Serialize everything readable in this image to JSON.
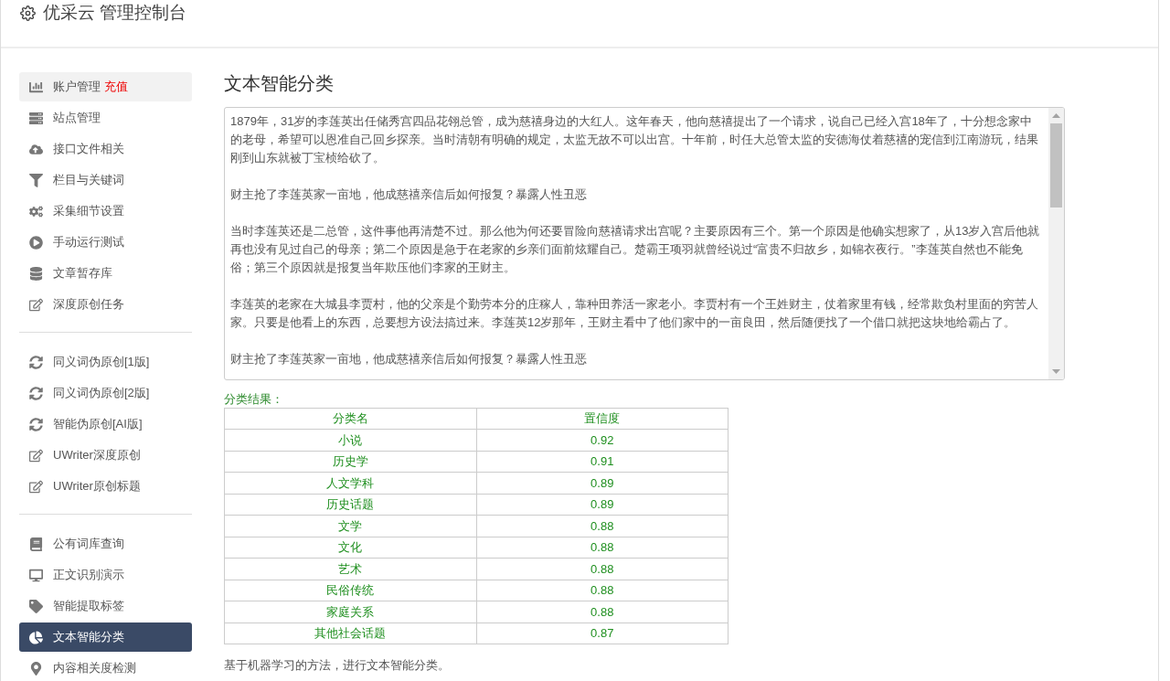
{
  "header": {
    "title": "优采云 管理控制台"
  },
  "sidebar": {
    "groups": [
      {
        "items": [
          {
            "label": "账户管理",
            "badge": "充值",
            "selected": false,
            "highlighted": true
          },
          {
            "label": "站点管理",
            "selected": false,
            "highlighted": false
          },
          {
            "label": "接口文件相关",
            "selected": false,
            "highlighted": false
          },
          {
            "label": "栏目与关键词",
            "selected": false,
            "highlighted": false
          },
          {
            "label": "采集细节设置",
            "selected": false,
            "highlighted": false
          },
          {
            "label": "手动运行测试",
            "selected": false,
            "highlighted": false
          },
          {
            "label": "文章暂存库",
            "selected": false,
            "highlighted": false
          },
          {
            "label": "深度原创任务",
            "selected": false,
            "highlighted": false
          }
        ]
      },
      {
        "items": [
          {
            "label": "同义词伪原创[1版]",
            "selected": false,
            "highlighted": false
          },
          {
            "label": "同义词伪原创[2版]",
            "selected": false,
            "highlighted": false
          },
          {
            "label": "智能伪原创[AI版]",
            "selected": false,
            "highlighted": false
          },
          {
            "label": "UWriter深度原创",
            "selected": false,
            "highlighted": false
          },
          {
            "label": "UWriter原创标题",
            "selected": false,
            "highlighted": false
          }
        ]
      },
      {
        "items": [
          {
            "label": "公有词库查询",
            "selected": false,
            "highlighted": false
          },
          {
            "label": "正文识别演示",
            "selected": false,
            "highlighted": false
          },
          {
            "label": "智能提取标签",
            "selected": false,
            "highlighted": false
          },
          {
            "label": "文本智能分类",
            "selected": true
          },
          {
            "label": "内容相关度检测",
            "selected": false,
            "highlighted": false
          }
        ]
      }
    ]
  },
  "main": {
    "title": "文本智能分类",
    "text_area": {
      "paragraphs": [
        "1879年，31岁的李莲英出任储秀宫四品花翎总管，成为慈禧身边的大红人。这年春天，他向慈禧提出了一个请求，说自己已经入宫18年了，十分想念家中的老母，希望可以恩准自己回乡探亲。当时清朝有明确的规定，太监无故不可以出宫。十年前，时任大总管太监的安德海仗着慈禧的宠信到江南游玩，结果刚到山东就被丁宝桢给砍了。",
        "财主抢了李莲英家一亩地，他成慈禧亲信后如何报复？暴露人性丑恶",
        "当时李莲英还是二总管，这件事他再清楚不过。那么他为何还要冒险向慈禧请求出宫呢？主要原因有三个。第一个原因是他确实想家了，从13岁入宫后他就再也没有见过自己的母亲；第二个原因是急于在老家的乡亲们面前炫耀自己。楚霸王项羽就曾经说过“富贵不归故乡，如锦衣夜行。”李莲英自然也不能免俗；第三个原因就是报复当年欺压他们李家的王财主。",
        "李莲英的老家在大城县李贾村，他的父亲是个勤劳本分的庄稼人，靠种田养活一家老小。李贾村有一个王姓财主，仗着家里有钱，经常欺负村里面的穷苦人家。只要是他看上的东西，总要想方设法搞过来。李莲英12岁那年，王财主看中了他们家中的一亩良田，然后随便找了一个借口就把这块地给霸占了。",
        "财主抢了李莲英家一亩地，他成慈禧亲信后如何报复？暴露人性丑恶"
      ]
    },
    "result_label": "分类结果：",
    "table": {
      "columns": [
        "分类名",
        "置信度"
      ],
      "rows": [
        [
          "小说",
          "0.92"
        ],
        [
          "历史学",
          "0.91"
        ],
        [
          "人文学科",
          "0.89"
        ],
        [
          "历史话题",
          "0.89"
        ],
        [
          "文学",
          "0.88"
        ],
        [
          "文化",
          "0.88"
        ],
        [
          "艺术",
          "0.88"
        ],
        [
          "民俗传统",
          "0.88"
        ],
        [
          "家庭关系",
          "0.88"
        ],
        [
          "其他社会话题",
          "0.87"
        ]
      ]
    },
    "footer_note": "基于机器学习的方法，进行文本智能分类。"
  }
}
